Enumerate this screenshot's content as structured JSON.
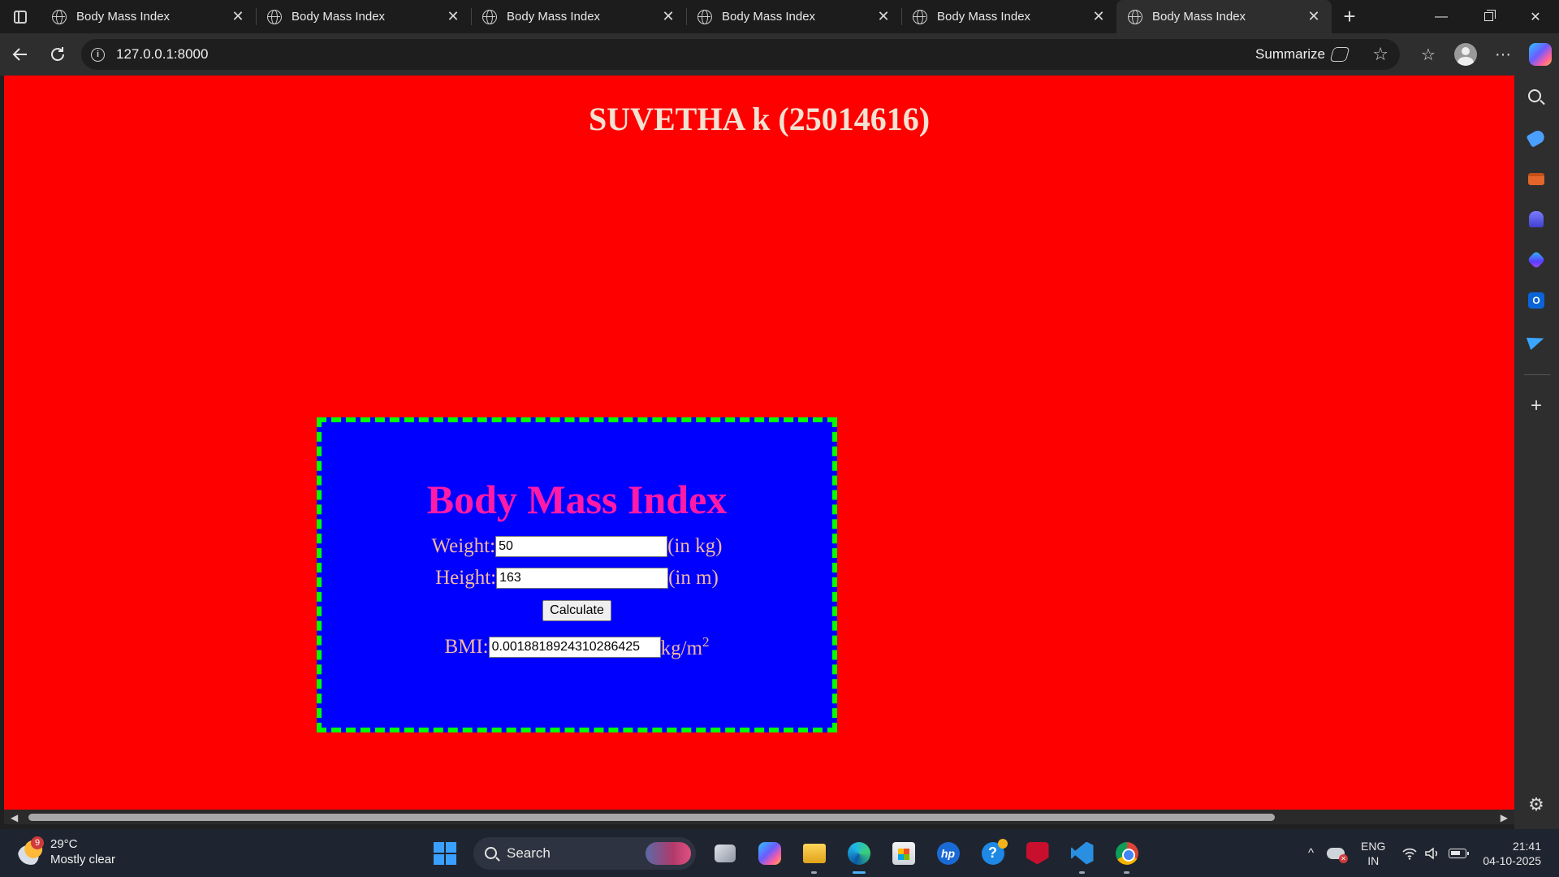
{
  "browser": {
    "tabs": [
      {
        "title": "Body Mass Index",
        "active": false
      },
      {
        "title": "Body Mass Index",
        "active": false
      },
      {
        "title": "Body Mass Index",
        "active": false
      },
      {
        "title": "Body Mass Index",
        "active": false
      },
      {
        "title": "Body Mass Index",
        "active": false
      },
      {
        "title": "Body Mass Index",
        "active": true
      }
    ],
    "tab_close_glyph": "✕",
    "new_tab_glyph": "+",
    "window": {
      "minimize": "—",
      "close": "✕"
    },
    "url": "127.0.0.1:8000",
    "summarize_label": "Summarize",
    "icons": {
      "back": "back-arrow-icon",
      "reload": "reload-icon",
      "info": "info-icon",
      "favorite": "star-icon",
      "favorites": "favorites-icon",
      "profile": "avatar-icon",
      "more": "more-icon",
      "copilot": "copilot-icon"
    }
  },
  "page": {
    "heading": "SUVETHA k (25014616)",
    "background": "#ff0000",
    "form": {
      "title": "Body Mass Index",
      "weight_label": "Weight:",
      "weight_value": "50",
      "weight_unit": "(in kg)",
      "height_label": "Height:",
      "height_value": "163",
      "height_unit": "(in m)",
      "calculate_label": "Calculate",
      "bmi_label": "BMI:",
      "bmi_value": "0.0018818924310286425",
      "bmi_unit": "kg/m",
      "bmi_unit_sup": "2",
      "box_color": "#0000ff",
      "border_color": "#00ff00",
      "title_color": "#ff1aa8"
    }
  },
  "sidebar": {
    "items": [
      "search-icon",
      "shopping-tag-icon",
      "tools-icon",
      "games-icon",
      "microsoft365-icon",
      "outlook-icon",
      "send-icon",
      "add-icon",
      "settings-icon"
    ],
    "outlook_letter": "O",
    "plus_glyph": "+",
    "gear_glyph": "⚙"
  },
  "taskbar": {
    "weather": {
      "temp": "29°C",
      "condition": "Mostly clear",
      "badge": "9"
    },
    "search_label": "Search",
    "apps": [
      "task-view-icon",
      "copilot-icon",
      "file-explorer-icon",
      "edge-icon",
      "store-icon",
      "hp-icon",
      "help-icon",
      "mcafee-icon",
      "vscode-icon",
      "chrome-icon"
    ],
    "hp_text": "hp",
    "help_text": "?",
    "tray": {
      "chevron": "^",
      "lang_line1": "ENG",
      "lang_line2": "IN",
      "time": "21:41",
      "date": "04-10-2025"
    }
  }
}
